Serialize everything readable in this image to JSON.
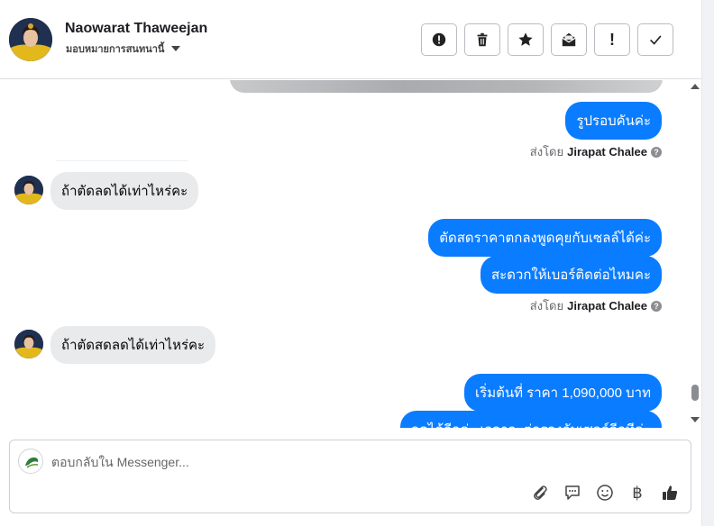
{
  "header": {
    "name": "Naowarat Thaweejan",
    "assign_label": "มอบหมายการสนทนานี้",
    "actions": [
      {
        "icon": "alert-circle-icon",
        "label": "Mark as spam"
      },
      {
        "icon": "trash-icon",
        "label": "Delete"
      },
      {
        "icon": "star-icon",
        "label": "Star"
      },
      {
        "icon": "mark-unread-icon",
        "label": "Mark as unread"
      },
      {
        "icon": "exclamation-icon",
        "label": "!"
      },
      {
        "icon": "checkmark-icon",
        "label": "Mark as done"
      }
    ]
  },
  "thread": {
    "messages": [
      {
        "dir": "out",
        "text": "รูปรอบคันค่ะ"
      },
      {
        "dir": "meta",
        "prefix": "ส่งโดย",
        "sender": "Jirapat Chalee"
      },
      {
        "dir": "in",
        "text": "ถ้าตัดลดได้เท่าไหร่คะ"
      },
      {
        "dir": "out",
        "text": "ตัดสดราคาตกลงพูดคุยกับเซลล์ได้ค่ะ"
      },
      {
        "dir": "out",
        "text": "สะดวกให้เบอร์ติดต่อไหมคะ"
      },
      {
        "dir": "meta",
        "prefix": "ส่งโดย",
        "sender": "Jirapat Chalee"
      },
      {
        "dir": "in",
        "text": "ถ้าตัดสดลดได้เท่าไหร่คะ"
      },
      {
        "dir": "out",
        "text": "เริ่มต้นที่ ราคา 1,090,000 บาท"
      },
      {
        "dir": "out",
        "text": "ลดได้อีกค่ะ เวลาจะต่อรองกับเซลล์อีกทีค่ะ"
      }
    ]
  },
  "composer": {
    "placeholder": "ตอบกลับใน Messenger...",
    "tools": [
      "paperclip-icon",
      "saved-reply-icon",
      "emoji-icon",
      "baht-icon",
      "thumbs-up-icon"
    ],
    "baht_symbol": "฿"
  },
  "colors": {
    "outgoing_bubble": "#0a7cff",
    "incoming_bubble": "#e9eaec"
  }
}
